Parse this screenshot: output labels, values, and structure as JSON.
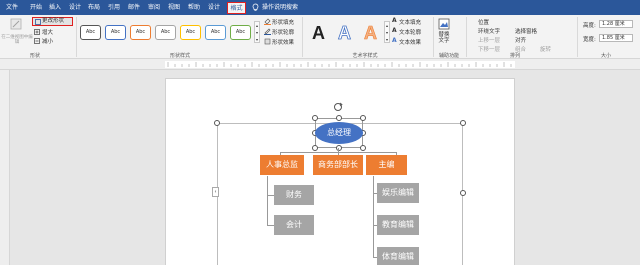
{
  "tabs": [
    "文件",
    "开始",
    "插入",
    "设计",
    "布局",
    "引用",
    "邮件",
    "审阅",
    "视图",
    "帮助",
    "设计",
    "格式"
  ],
  "active_tab_index": 11,
  "search_label": "操作说明搜索",
  "ribbon": {
    "shape_group": {
      "edit_in_2d": "在二维视图中编辑",
      "change_shape": "更改形状",
      "larger": "增大",
      "smaller": "减小",
      "label": "形状"
    },
    "shape_styles": {
      "style_labels": [
        "Abc",
        "Abc",
        "Abc",
        "Abc",
        "Abc",
        "Abc",
        "Abc"
      ],
      "style_colors": [
        "#555555",
        "#4472c4",
        "#ed7d31",
        "#a5a5a5",
        "#ffc000",
        "#5b9bd5",
        "#70ad47"
      ],
      "fill": "形状填充",
      "outline": "形状轮廓",
      "effects": "形状效果",
      "label": "形状样式"
    },
    "wordart": {
      "letters": [
        "A",
        "A",
        "A"
      ],
      "text_fill": "文本填充",
      "text_outline": "文本轮廓",
      "text_effects": "文本效果",
      "label": "艺术字样式"
    },
    "accessibility": {
      "alt_text": "替换文字",
      "label": "辅助功能"
    },
    "arrange": {
      "position": "位置",
      "wrap_text": "环绕文字",
      "bring_forward": "上移一层",
      "send_backward": "下移一层",
      "selection_pane": "选择窗格",
      "align": "对齐",
      "group": "组合",
      "rotate": "旋转",
      "label": "排列"
    },
    "size": {
      "height_label": "高度:",
      "height_value": "1.28 厘米",
      "width_label": "宽度:",
      "width_value": "1.85 厘米",
      "label": "大小"
    }
  },
  "chart": {
    "root": "总经理",
    "level2": [
      "人事总监",
      "商务部部长",
      "主编"
    ],
    "hr_children": [
      "财务",
      "会计"
    ],
    "editor_children": [
      "娱乐编辑",
      "教育编辑",
      "体育编辑"
    ]
  },
  "colors": {
    "ribbon_blue": "#2b579a",
    "root_fill": "#4472c4",
    "level2_fill": "#ed7d31",
    "child_fill": "#a5a5a5",
    "highlight": "#e02020"
  }
}
